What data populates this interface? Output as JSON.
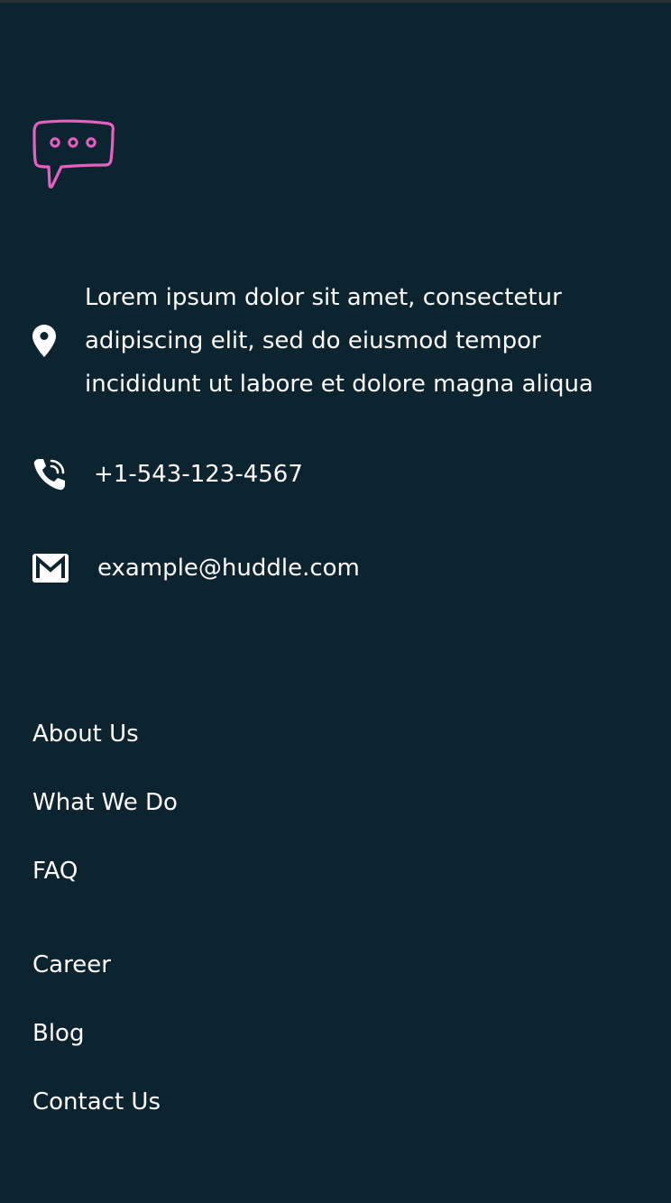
{
  "footer": {
    "logo_icon": "chat-bubble-icon",
    "accent_color": "#e660c0",
    "background_color": "#0c2330",
    "contact": {
      "address": {
        "icon": "location-pin-icon",
        "text": "Lorem ipsum dolor sit amet, consectetur adipiscing elit, sed do eiusmod tempor incididunt ut labore et dolore magna aliqua"
      },
      "phone": {
        "icon": "phone-icon",
        "text": "+1-543-123-4567"
      },
      "email": {
        "icon": "mail-icon",
        "text": "example@huddle.com"
      }
    },
    "links_group_1": [
      {
        "label": "About Us"
      },
      {
        "label": "What We Do"
      },
      {
        "label": "FAQ"
      }
    ],
    "links_group_2": [
      {
        "label": "Career"
      },
      {
        "label": "Blog"
      },
      {
        "label": "Contact Us"
      }
    ]
  }
}
